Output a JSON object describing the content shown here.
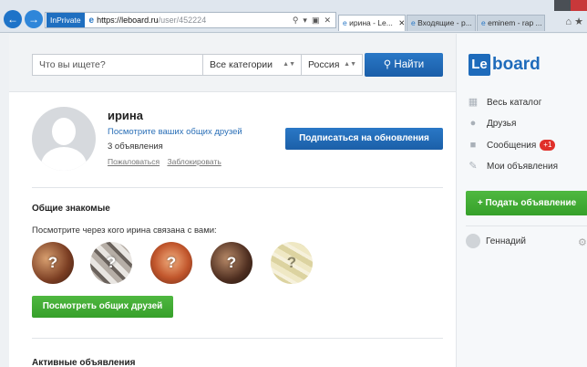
{
  "browser": {
    "inprivate": "InPrivate",
    "url_host": "https://leboard.ru",
    "url_path": "/user/452224",
    "tabs": [
      {
        "label": "ирина - Le..."
      },
      {
        "label": "Входящие - р..."
      },
      {
        "label": "eminem - rap ..."
      }
    ]
  },
  "search": {
    "placeholder": "Что вы ищете?",
    "category": "Все категории",
    "region": "Россия",
    "button": "Найти"
  },
  "profile": {
    "name": "ирина",
    "mutual_link": "Посмотрите ваших общих друзей",
    "ads_count": "3 объявления",
    "complain": "Пожаловаться",
    "block": "Заблокировать",
    "subscribe": "Подписаться на обновления"
  },
  "mutual": {
    "title": "Общие знакомые",
    "via": "Посмотрите через кого ирина связана с вами:",
    "button": "Посмотреть общих друзей"
  },
  "active_ads": {
    "title": "Активные объявления"
  },
  "sidebar": {
    "logo_box": "Le",
    "logo_text": "board",
    "items": [
      {
        "label": "Весь каталог",
        "icon": "grid-icon"
      },
      {
        "label": "Друзья",
        "icon": "person-icon"
      },
      {
        "label": "Сообщения",
        "icon": "message-icon",
        "badge": "+1"
      },
      {
        "label": "Мои объявления",
        "icon": "pencil-icon"
      }
    ],
    "post_ad": "+ Подать объявление",
    "user_name": "Геннадий"
  }
}
